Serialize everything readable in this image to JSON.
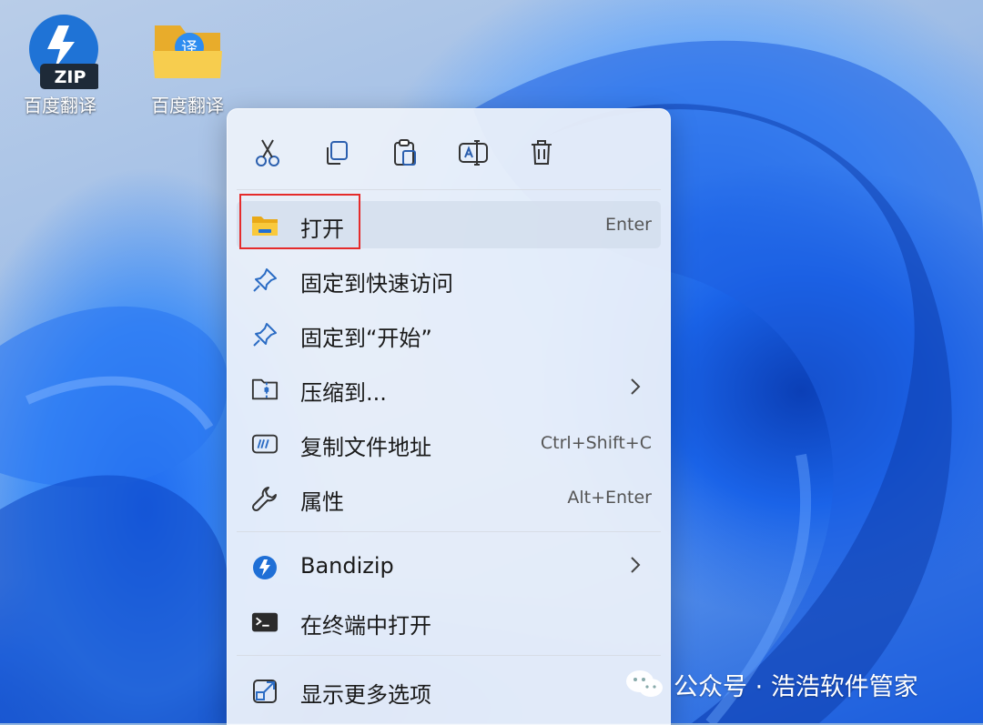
{
  "desktop": {
    "icons": [
      {
        "label": "百度翻译",
        "badge": "ZIP",
        "icon": "bandizip-archive-icon"
      },
      {
        "label": "百度翻译",
        "badge": "译",
        "icon": "folder-icon"
      }
    ]
  },
  "context_menu": {
    "toolbar": [
      {
        "name": "cut",
        "icon": "scissors-icon"
      },
      {
        "name": "copy",
        "icon": "copy-icon"
      },
      {
        "name": "paste",
        "icon": "clipboard-icon"
      },
      {
        "name": "rename",
        "icon": "rename-icon"
      },
      {
        "name": "delete",
        "icon": "trash-icon"
      }
    ],
    "items": [
      {
        "label": "打开",
        "shortcut": "Enter",
        "icon": "folder-icon",
        "highlighted": true
      },
      {
        "label": "固定到快速访问",
        "shortcut": "",
        "icon": "pin-icon"
      },
      {
        "label": "固定到“开始”",
        "shortcut": "",
        "icon": "pin-icon"
      },
      {
        "label": "压缩到...",
        "shortcut": "",
        "icon": "zip-folder-icon",
        "submenu": true
      },
      {
        "label": "复制文件地址",
        "shortcut": "Ctrl+Shift+C",
        "icon": "path-icon"
      },
      {
        "label": "属性",
        "shortcut": "Alt+Enter",
        "icon": "wrench-icon"
      },
      {
        "label": "Bandizip",
        "shortcut": "",
        "icon": "bandizip-icon",
        "submenu": true
      },
      {
        "label": "在终端中打开",
        "shortcut": "",
        "icon": "terminal-icon"
      },
      {
        "label": "显示更多选项",
        "shortcut": "",
        "icon": "external-open-icon"
      }
    ]
  },
  "watermark": {
    "text": "公众号 · 浩浩软件管家",
    "icon": "wechat-icon"
  },
  "colors": {
    "accent": "#0067c0",
    "highlight_box": "#e52b2b",
    "menu_bg": "#ecf1fa",
    "folder_yellow": "#f5c53b"
  }
}
